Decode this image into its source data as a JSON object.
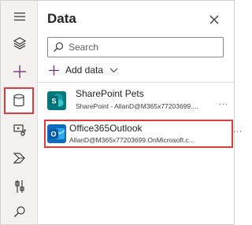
{
  "panel": {
    "title": "Data",
    "search_placeholder": "Search",
    "add_data_label": "Add data"
  },
  "connections": [
    {
      "name": "SharePoint Pets",
      "subtitle": "SharePoint - AllanD@M365x77203699....",
      "more": "...",
      "icon": "sharepoint-icon",
      "color": "#03787c"
    },
    {
      "name": "Office365Outlook",
      "subtitle": "AllanD@M365x77203699.OnMicrosoft.c...",
      "more": "...",
      "icon": "outlook-icon",
      "color": "#0f6cbd"
    }
  ],
  "rail": {
    "items": [
      "hamburger-icon",
      "layers-icon",
      "plus-icon",
      "database-icon",
      "media-icon",
      "power-automate-icon",
      "tools-icon",
      "search-icon"
    ],
    "selected": "database-icon"
  },
  "colors": {
    "highlight": "#e03b3b",
    "rail_bg": "#f3f2f1",
    "accent": "#742774"
  }
}
